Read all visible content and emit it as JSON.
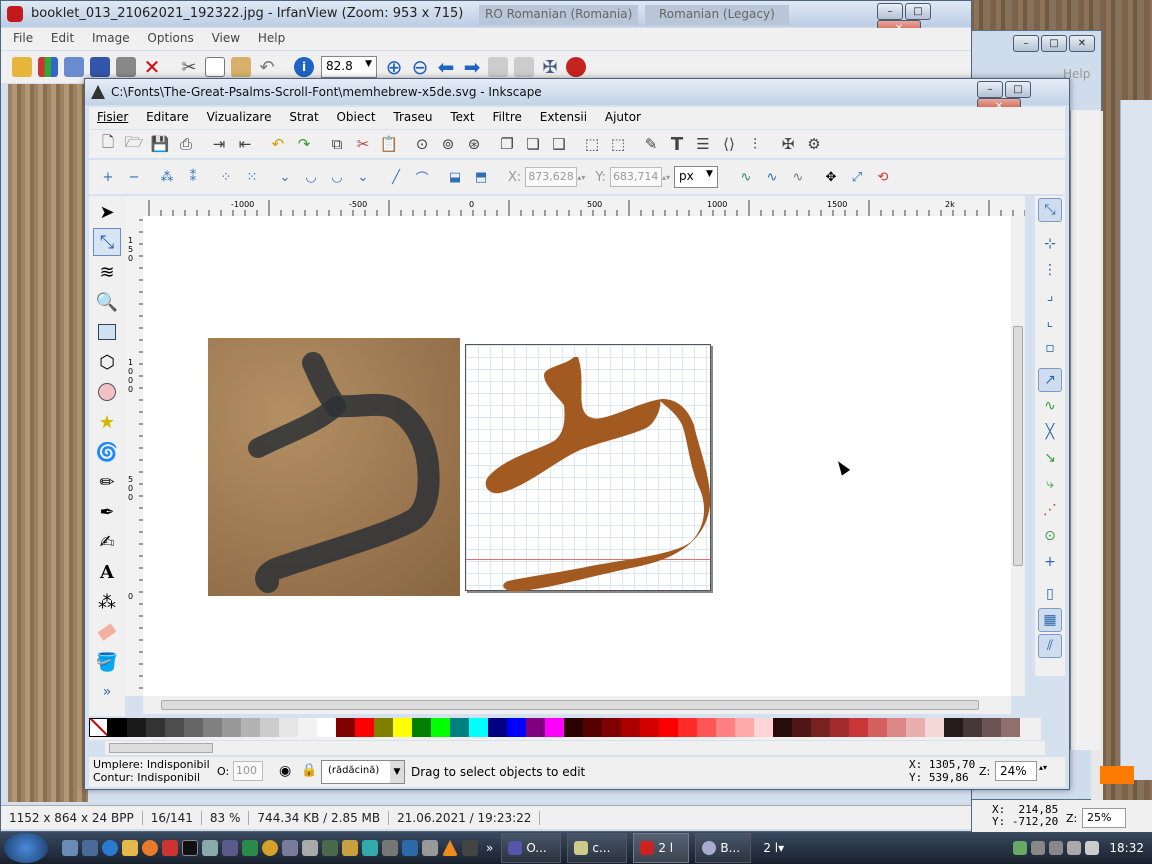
{
  "irfan": {
    "title": "booklet_013_21062021_192322.jpg - IrfanView (Zoom: 953 x 715)",
    "lang_tab1": "RO Romanian (Romania)",
    "lang_tab2": "Romanian (Legacy)",
    "menu": [
      "File",
      "Edit",
      "Image",
      "Options",
      "View",
      "Help"
    ],
    "zoom": "82.8",
    "status": [
      "1152 x 864 x 24 BPP",
      "16/141",
      "83 %",
      "744.34 KB / 2.85 MB",
      "21.06.2021 / 19:23:22"
    ]
  },
  "bg_window": {
    "help": "Help",
    "coords": "X:  214,85\nY: -712,20",
    "zoom_label": "Z:",
    "zoom": "25%"
  },
  "inkscape": {
    "title": "C:\\Fonts\\The-Great-Psalms-Scroll-Font\\memhebrew-x5de.svg - Inkscape",
    "menu": [
      "Fisier",
      "Editare",
      "Vizualizare",
      "Strat",
      "Obiect",
      "Traseu",
      "Text",
      "Filtre",
      "Extensii",
      "Ajutor"
    ],
    "x_label": "X:",
    "x_value": "873,628",
    "y_label": "Y:",
    "y_value": "683,714",
    "unit": "px",
    "ruler_ticks": [
      "-1000",
      "-500",
      "0",
      "500",
      "1000",
      "1500",
      "2k"
    ],
    "vruler": [
      "1 5 0",
      "1 0 0 0",
      "5 0 0",
      "0"
    ],
    "fill_label": "Umplere:",
    "fill_value": "Indisponibil",
    "stroke_label": "Contur:",
    "stroke_value": "Indisponibil",
    "opacity_label": "O:",
    "opacity": "100",
    "layer": "(rădăcină)",
    "message": "Drag to select objects to edit",
    "cursor_x": "X: 1305,70",
    "cursor_y": "Y:  539,86",
    "zoom_label": "Z:",
    "zoom": "24%",
    "palette": [
      "#000000",
      "#1a1a1a",
      "#333333",
      "#4d4d4d",
      "#666666",
      "#808080",
      "#999999",
      "#b3b3b3",
      "#cccccc",
      "#e6e6e6",
      "#f2f2f2",
      "#ffffff",
      "#800000",
      "#ff0000",
      "#808000",
      "#ffff00",
      "#008000",
      "#00ff00",
      "#008080",
      "#00ffff",
      "#000080",
      "#0000ff",
      "#800080",
      "#ff00ff",
      "#2b0000",
      "#550000",
      "#800000",
      "#aa0000",
      "#d40000",
      "#ff0000",
      "#ff2a2a",
      "#ff5555",
      "#ff8080",
      "#ffaaaa",
      "#ffd5d5",
      "#280b0b",
      "#501616",
      "#782121",
      "#a02c2c",
      "#c83737",
      "#d35f5f",
      "#de8787",
      "#e9afaf",
      "#f4d7d7",
      "#241c1c",
      "#483737",
      "#6c5353",
      "#916f6f"
    ]
  },
  "taskbar": {
    "items": [
      "O...",
      "c...",
      "2 l",
      "B..."
    ],
    "tray_count": "2 l",
    "clock": "18:32"
  }
}
